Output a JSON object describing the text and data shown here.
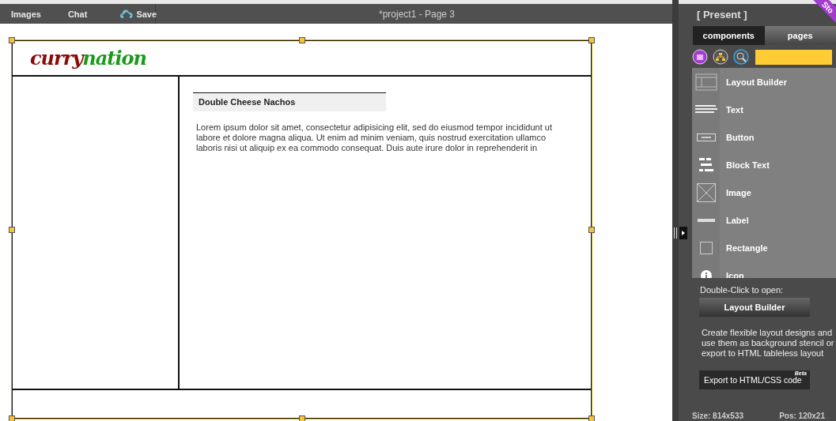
{
  "toolbar": {
    "items": [
      {
        "label": "Images",
        "kind": "text"
      },
      {
        "label": "Chat",
        "kind": "text"
      },
      {
        "label": "Save",
        "kind": "cloud"
      }
    ],
    "title": "*project1 - Page 3"
  },
  "canvas": {
    "logo": {
      "first": "curry",
      "second": "nation"
    },
    "heading": "Double Cheese Nachos",
    "paragraph": "Lorem ipsum dolor sit amet, consectetur adipisicing elit, sed do eiusmod tempor incididunt ut labore et dolore magna aliqua. Ut enim ad minim veniam, quis nostrud exercitation ullamco laboris nisi ut aliquip ex ea commodo consequat. Duis aute irure dolor in reprehenderit in"
  },
  "sidebar": {
    "title": "[ Present ]",
    "ribbon": "Sto",
    "tabs": [
      {
        "label": "components",
        "selected": true
      },
      {
        "label": "pages",
        "selected": false
      }
    ],
    "components": [
      {
        "label": "Layout Builder",
        "kind": "layout"
      },
      {
        "label": "Text",
        "kind": "text"
      },
      {
        "label": "Button",
        "kind": "button"
      },
      {
        "label": "Block Text",
        "kind": "blocktext"
      },
      {
        "label": "Image",
        "kind": "image"
      },
      {
        "label": "Label",
        "kind": "label"
      },
      {
        "label": "Rectangle",
        "kind": "rectangle"
      },
      {
        "label": "Icon",
        "kind": "info"
      }
    ],
    "hint": "Double-Click to open:",
    "open_button": "Layout Builder",
    "description": "Create flexible layout designs and use them as background stencil or export to HTML tableless layout",
    "export_button": "Export to HTML/CSS code",
    "export_badge": "Beta",
    "size": "Size: 814x533",
    "pos": "Pos: 120x21"
  }
}
